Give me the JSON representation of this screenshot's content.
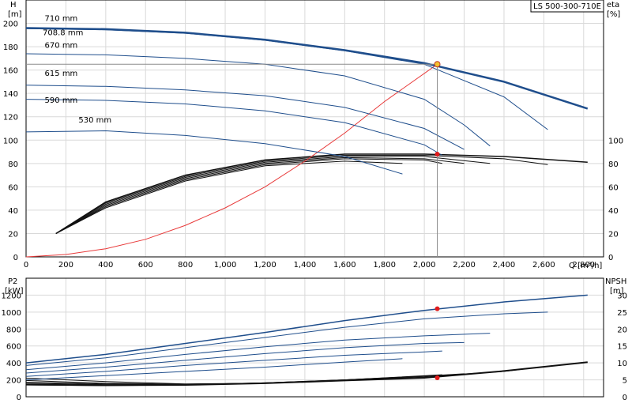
{
  "chart_data": [
    {
      "panel": "head",
      "type": "line",
      "legend_box": "LS 500-300-710E",
      "xlabel": "Q [m³/h]",
      "ylabel": [
        "H",
        "[m]"
      ],
      "ylabel_right": [
        "eta",
        "[%]"
      ],
      "xlim": [
        0,
        2900
      ],
      "ylim": [
        0,
        220
      ],
      "ylim_right": [
        0,
        220
      ],
      "x_ticks": [
        0,
        200,
        400,
        600,
        800,
        1000,
        1200,
        1400,
        1600,
        1800,
        2000,
        2200,
        2400,
        2600,
        2800
      ],
      "x_tick_labels": [
        "0",
        "200",
        "400",
        "600",
        "800",
        "1,000",
        "1,200",
        "1,400",
        "1,600",
        "1,800",
        "2,000",
        "2,200",
        "2,400",
        "2,600",
        "2,800"
      ],
      "y_ticks": [
        0,
        20,
        40,
        60,
        80,
        100,
        120,
        140,
        160,
        180,
        200
      ],
      "y_tick_labels": [
        "0",
        "20",
        "40",
        "60",
        "80",
        "100",
        "120",
        "140",
        "160",
        "180",
        "200"
      ],
      "y_ticks_right": [
        0,
        20,
        40,
        60,
        80,
        100
      ],
      "y_tick_labels_right": [
        "0",
        "20",
        "40",
        "60",
        "80",
        "100"
      ],
      "grid": true,
      "head_curves": [
        {
          "name": "710 mm",
          "label_at": [
            30,
            204
          ],
          "color": "#1f4e8c",
          "width": 2.5,
          "x": [
            0,
            400,
            800,
            1200,
            1600,
            2000,
            2400,
            2820
          ],
          "y": [
            196,
            195,
            192,
            186,
            177,
            166,
            150,
            127
          ]
        },
        {
          "name": "708.8 mm",
          "label_at": [
            20,
            192
          ],
          "color": "#1f4e8c",
          "width": 1,
          "x": [
            0,
            400,
            800,
            1200,
            1600,
            2000,
            2400,
            2620
          ],
          "y": [
            195.5,
            194.5,
            191.5,
            185.5,
            176.5,
            165,
            137,
            109
          ]
        },
        {
          "name": "670 mm",
          "label_at": [
            30,
            181
          ],
          "color": "#1f4e8c",
          "width": 1,
          "x": [
            0,
            400,
            800,
            1200,
            1600,
            2000,
            2200,
            2330
          ],
          "y": [
            174,
            173,
            170,
            165,
            155,
            135,
            113,
            95
          ]
        },
        {
          "name": "615 mm",
          "label_at": [
            30,
            157
          ],
          "color": "#1f4e8c",
          "width": 1,
          "x": [
            0,
            400,
            800,
            1200,
            1600,
            2000,
            2200
          ],
          "y": [
            147,
            146,
            143,
            138,
            128,
            110,
            92
          ]
        },
        {
          "name": "590 mm",
          "label_at": [
            30,
            134
          ],
          "color": "#1f4e8c",
          "width": 1,
          "x": [
            0,
            400,
            800,
            1200,
            1600,
            2000,
            2090
          ],
          "y": [
            135,
            134,
            131,
            125,
            115,
            96,
            87
          ]
        },
        {
          "name": "530 mm",
          "label_at": [
            200,
            117
          ],
          "color": "#1f4e8c",
          "width": 1,
          "x": [
            0,
            400,
            800,
            1200,
            1600,
            1890
          ],
          "y": [
            107,
            108,
            104,
            97,
            86,
            71
          ]
        }
      ],
      "efficiency_curves": [
        {
          "x": [
            150,
            400,
            800,
            1200,
            1600,
            2000,
            2400,
            2820
          ],
          "y": [
            20,
            47,
            70,
            83,
            88,
            88,
            86,
            81
          ],
          "width": 1.5
        },
        {
          "x": [
            150,
            400,
            800,
            1200,
            1600,
            2000,
            2400,
            2620
          ],
          "y": [
            20,
            46,
            69,
            82,
            87,
            87,
            84,
            79
          ],
          "width": 1
        },
        {
          "x": [
            150,
            400,
            800,
            1200,
            1600,
            2000,
            2330
          ],
          "y": [
            20,
            45,
            68,
            81,
            86,
            86,
            80
          ],
          "width": 1
        },
        {
          "x": [
            150,
            400,
            800,
            1200,
            1600,
            2000,
            2200
          ],
          "y": [
            20,
            44,
            67,
            80,
            85,
            84,
            80
          ],
          "width": 1
        },
        {
          "x": [
            150,
            400,
            800,
            1200,
            1600,
            2000,
            2090
          ],
          "y": [
            20,
            43,
            66,
            79,
            84,
            83,
            80
          ],
          "width": 1
        },
        {
          "x": [
            150,
            400,
            800,
            1200,
            1600,
            1890
          ],
          "y": [
            20,
            42,
            65,
            78,
            82,
            80
          ],
          "width": 1
        }
      ],
      "system_curve": {
        "color": "#e83a3a",
        "x": [
          0,
          200,
          400,
          600,
          800,
          1000,
          1200,
          1400,
          1600,
          1800,
          2065
        ],
        "y": [
          0,
          2,
          7,
          15,
          27,
          42,
          60,
          82,
          106,
          133,
          165
        ]
      },
      "duty_point": {
        "x": 2065,
        "y": 165,
        "fill": "#f2c12e",
        "stroke": "#c0392b"
      },
      "eta_point": {
        "x": 2065,
        "y": 88,
        "fill": "#e01b1b"
      },
      "duty_line_color": "#8c8c8c"
    },
    {
      "panel": "power",
      "type": "line",
      "ylabel": [
        "P2",
        "[kW]"
      ],
      "ylabel_right": [
        "NPSH",
        "[m]"
      ],
      "xlim": [
        0,
        2900
      ],
      "ylim": [
        0,
        1400
      ],
      "ylim_right": [
        0,
        35
      ],
      "y_ticks": [
        0,
        200,
        400,
        600,
        800,
        1000,
        1200
      ],
      "y_tick_labels": [
        "0",
        "200",
        "400",
        "600",
        "800",
        "1000",
        "1200"
      ],
      "y_ticks_right": [
        0,
        5,
        10,
        15,
        20,
        25,
        30
      ],
      "y_tick_labels_right": [
        "0",
        "5",
        "10",
        "15",
        "20",
        "25",
        "30"
      ],
      "grid": true,
      "power_curves": [
        {
          "x": [
            0,
            400,
            800,
            1200,
            1600,
            2000,
            2400,
            2820
          ],
          "y": [
            400,
            500,
            630,
            760,
            900,
            1020,
            1120,
            1200
          ],
          "width": 1.5
        },
        {
          "x": [
            0,
            400,
            800,
            1200,
            1600,
            2000,
            2400,
            2620
          ],
          "y": [
            370,
            460,
            580,
            700,
            820,
            920,
            980,
            1000
          ],
          "width": 1
        },
        {
          "x": [
            0,
            400,
            800,
            1200,
            1600,
            2000,
            2330
          ],
          "y": [
            320,
            400,
            500,
            590,
            670,
            720,
            750
          ],
          "width": 1
        },
        {
          "x": [
            0,
            400,
            800,
            1200,
            1600,
            2000,
            2200
          ],
          "y": [
            280,
            350,
            430,
            510,
            580,
            630,
            640
          ],
          "width": 1
        },
        {
          "x": [
            0,
            400,
            800,
            1200,
            1600,
            2000,
            2090
          ],
          "y": [
            240,
            300,
            370,
            430,
            490,
            530,
            540
          ],
          "width": 1
        },
        {
          "x": [
            0,
            400,
            800,
            1200,
            1600,
            1890
          ],
          "y": [
            200,
            250,
            300,
            350,
            410,
            450
          ],
          "width": 1
        }
      ],
      "npsh_curves": [
        {
          "x": [
            0,
            400,
            800,
            1200,
            1600,
            2000,
            2400,
            2820
          ],
          "y": [
            3.6,
            3.4,
            3.5,
            4.0,
            4.8,
            5.6,
            7.6,
            10.2
          ],
          "width": 2
        },
        {
          "x": [
            0,
            400,
            800,
            1200,
            1600,
            2000,
            2400,
            2620
          ],
          "y": [
            5.5,
            4.5,
            3.8,
            4.0,
            4.8,
            5.8,
            7.5,
            9.0
          ],
          "width": 1
        },
        {
          "x": [
            0,
            400,
            800,
            1200,
            1600,
            2000,
            2330
          ],
          "y": [
            4.8,
            4.0,
            3.7,
            4.0,
            4.9,
            6.0,
            7.2
          ],
          "width": 1
        },
        {
          "x": [
            0,
            400,
            800,
            1200,
            1600,
            2000,
            2200
          ],
          "y": [
            4.3,
            3.8,
            3.6,
            4.0,
            5.0,
            6.1,
            6.8
          ],
          "width": 1
        },
        {
          "x": [
            0,
            400,
            800,
            1200,
            1600,
            2000,
            2090
          ],
          "y": [
            4.0,
            3.6,
            3.6,
            4.1,
            5.0,
            6.2,
            6.5
          ],
          "width": 1
        },
        {
          "x": [
            0,
            400,
            800,
            1200,
            1600,
            1890
          ],
          "y": [
            3.5,
            3.3,
            3.5,
            4.1,
            5.0,
            5.8
          ],
          "width": 1
        }
      ],
      "power_point": {
        "x": 2065,
        "y": 1040,
        "fill": "#e01b1b"
      },
      "npsh_point": {
        "x": 2065,
        "y": 5.6,
        "fill": "#e01b1b"
      }
    }
  ]
}
